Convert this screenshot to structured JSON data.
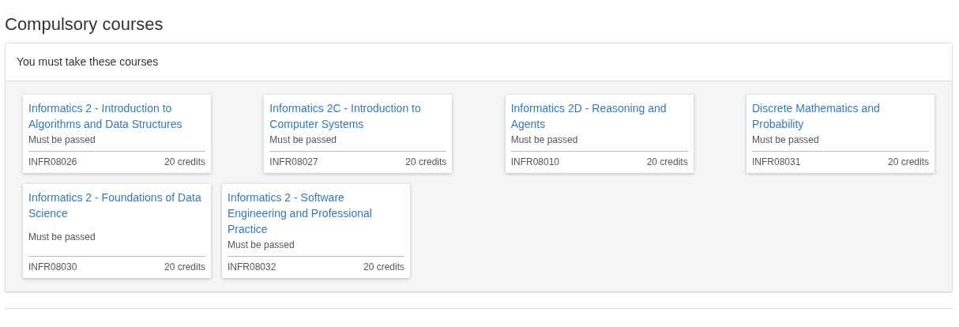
{
  "heading": "Compulsory courses",
  "panel": {
    "header": "You must take these courses",
    "rows": [
      [
        {
          "title": "Informatics 2 - Introduction to Algorithms and Data Structures",
          "requirement": "Must be passed",
          "code": "INFR08026",
          "credits": "20 credits"
        },
        {
          "title": "Informatics 2C - Introduction to Computer Systems",
          "requirement": "Must be passed",
          "code": "INFR08027",
          "credits": "20 credits"
        },
        {
          "title": "Informatics 2D - Reasoning and Agents",
          "requirement": "Must be passed",
          "code": "INFR08010",
          "credits": "20 credits"
        },
        {
          "title": "Discrete Mathematics and Probability",
          "requirement": "Must be passed",
          "code": "INFR08031",
          "credits": "20 credits"
        }
      ],
      [
        {
          "title": "Informatics 2 - Foundations of Data Science",
          "requirement": "Must be passed",
          "code": "INFR08030",
          "credits": "20 credits"
        },
        {
          "title": "Informatics 2 - Software Engineering and Professional Practice",
          "requirement": "Must be passed",
          "code": "INFR08032",
          "credits": "20 credits"
        }
      ]
    ]
  }
}
